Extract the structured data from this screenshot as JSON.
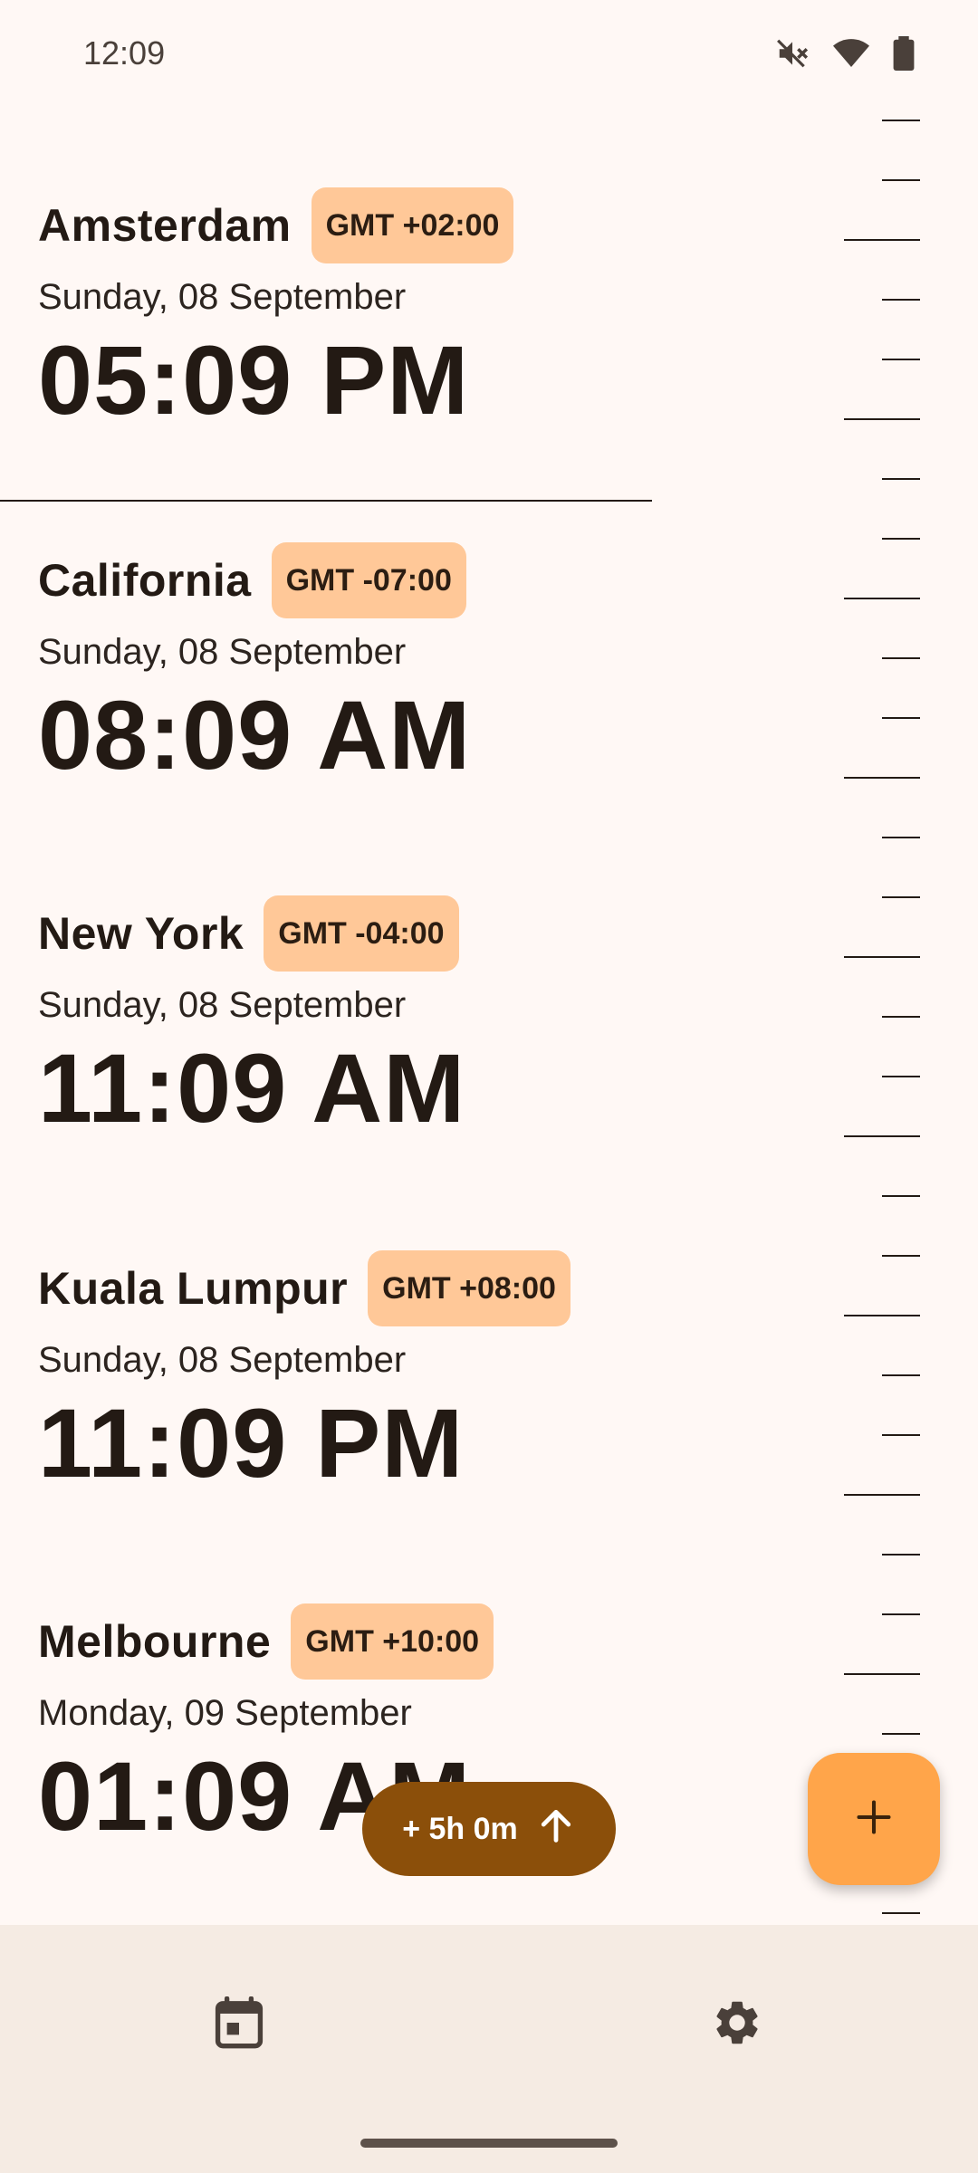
{
  "status_bar": {
    "time": "12:09",
    "icons": [
      "mute-icon",
      "wifi-icon",
      "battery-icon"
    ]
  },
  "cities": [
    {
      "name": "Amsterdam",
      "tz": "GMT +02:00",
      "date": "Sunday, 08 September",
      "time": "05:09 PM"
    },
    {
      "name": "California",
      "tz": "GMT -07:00",
      "date": "Sunday, 08 September",
      "time": "08:09 AM"
    },
    {
      "name": "New York",
      "tz": "GMT -04:00",
      "date": "Sunday, 08 September",
      "time": "11:09 AM"
    },
    {
      "name": "Kuala Lumpur",
      "tz": "GMT +08:00",
      "date": "Sunday, 08 September",
      "time": "11:09 PM"
    },
    {
      "name": "Melbourne",
      "tz": "GMT +10:00",
      "date": "Monday, 09 September",
      "time": "01:09 AM"
    }
  ],
  "offset_chip": {
    "label": "+ 5h 0m",
    "icon": "arrow-up-icon"
  },
  "fab": {
    "icon": "plus-icon"
  },
  "bottom_nav": {
    "items": [
      {
        "icon": "calendar-icon"
      },
      {
        "icon": "gear-icon"
      }
    ]
  },
  "colors": {
    "background": "#fff8f5",
    "badge": "#ffc898",
    "chip": "#8b4f0a",
    "fab": "#ffa54a",
    "nav": "#f5ebe3"
  }
}
